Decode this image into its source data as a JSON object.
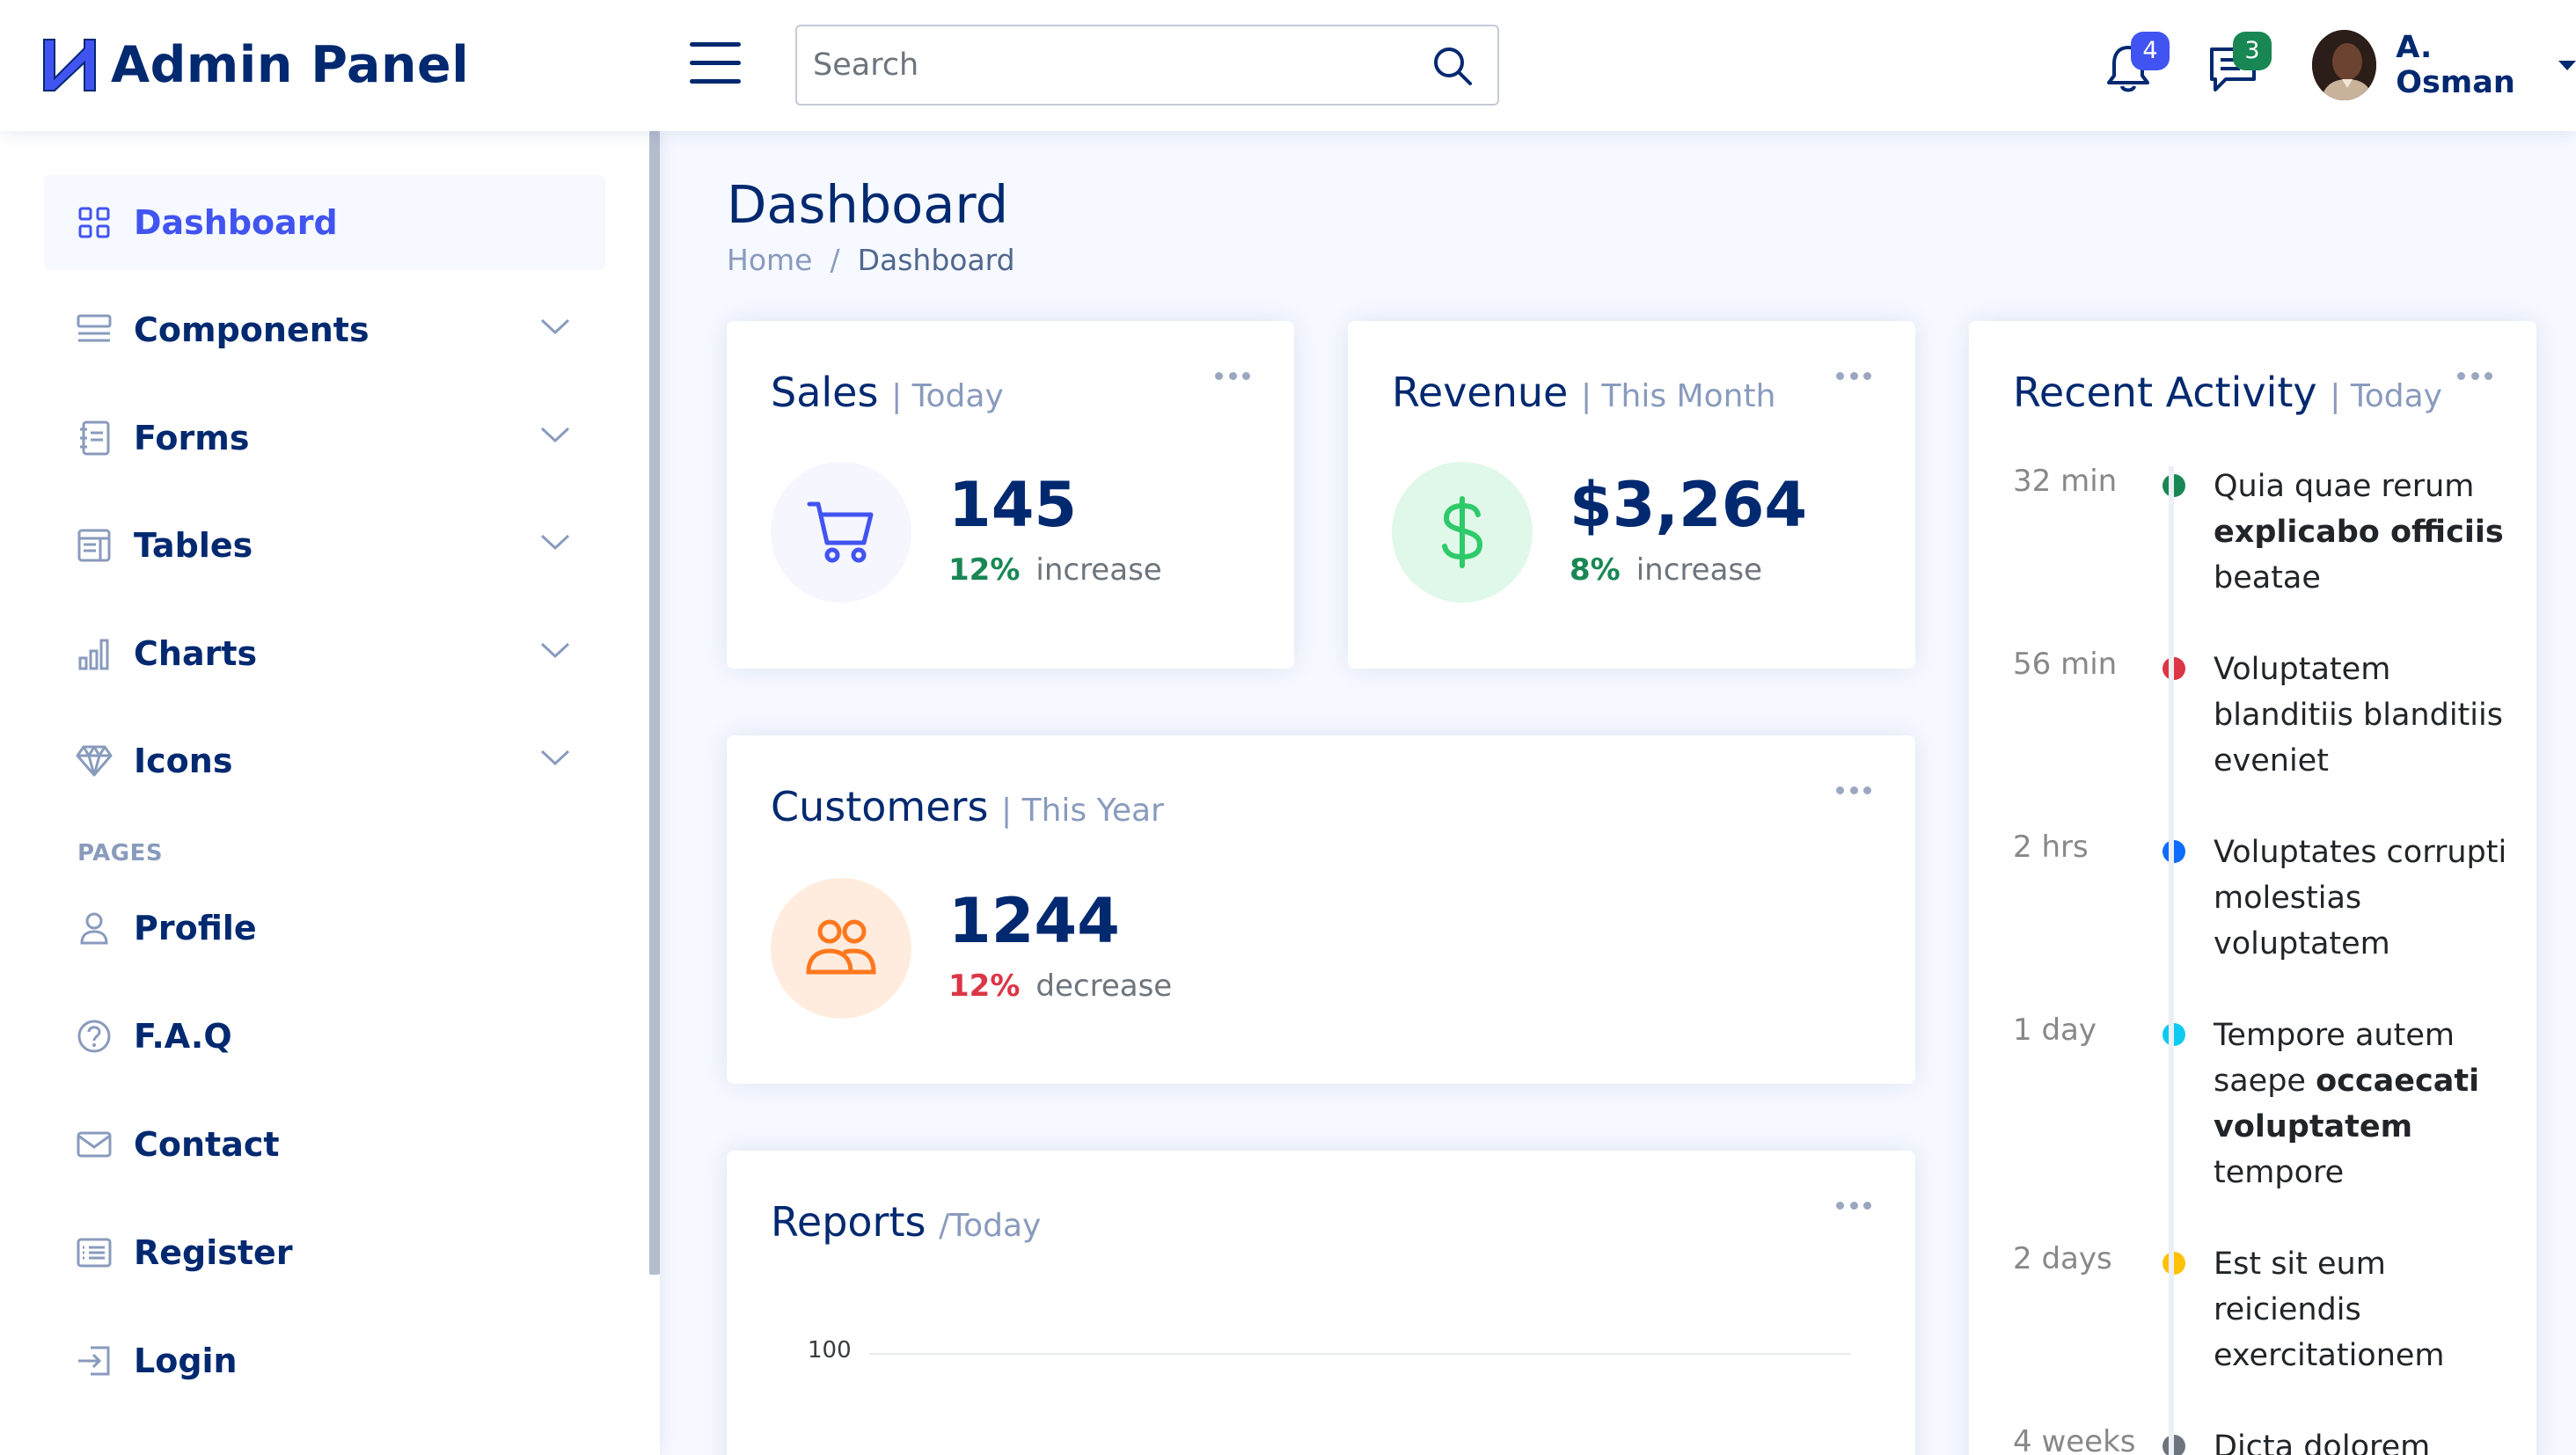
{
  "brand": {
    "name": "Admin Panel",
    "color": "#012970",
    "accent": "#4154f1"
  },
  "search": {
    "placeholder": "Search"
  },
  "header": {
    "notifications_count": "4",
    "messages_count": "3",
    "notifications_badge_color": "#4154f1",
    "messages_badge_color": "#198754",
    "user_name": "A. Osman"
  },
  "sidebar": {
    "items": [
      {
        "label": "Dashboard",
        "icon": "grid-icon",
        "active": true
      },
      {
        "label": "Components",
        "icon": "menu-button-icon",
        "expandable": true
      },
      {
        "label": "Forms",
        "icon": "journal-text-icon",
        "expandable": true
      },
      {
        "label": "Tables",
        "icon": "layout-text-window-icon",
        "expandable": true
      },
      {
        "label": "Charts",
        "icon": "bar-chart-icon",
        "expandable": true
      },
      {
        "label": "Icons",
        "icon": "gem-icon",
        "expandable": true
      }
    ],
    "pages_heading": "PAGES",
    "pages": [
      {
        "label": "Profile",
        "icon": "person-icon"
      },
      {
        "label": "F.A.Q",
        "icon": "question-circle-icon"
      },
      {
        "label": "Contact",
        "icon": "envelope-icon"
      },
      {
        "label": "Register",
        "icon": "card-list-icon"
      },
      {
        "label": "Login",
        "icon": "box-arrow-in-right-icon"
      }
    ]
  },
  "page": {
    "title": "Dashboard",
    "breadcrumb": {
      "home": "Home",
      "separator": "/",
      "current": "Dashboard"
    }
  },
  "cards": {
    "sales": {
      "title": "Sales",
      "filter": "| Today",
      "value": "145",
      "change_pct": "12%",
      "change_word": "increase",
      "change_color": "#198754",
      "icon": "cart-icon"
    },
    "revenue": {
      "title": "Revenue",
      "filter": "| This Month",
      "value": "$3,264",
      "change_pct": "8%",
      "change_word": "increase",
      "change_color": "#198754",
      "icon": "currency-dollar-icon"
    },
    "customers": {
      "title": "Customers",
      "filter": "| This Year",
      "value": "1244",
      "change_pct": "12%",
      "change_word": "decrease",
      "change_color": "#dc3545",
      "icon": "people-icon"
    },
    "reports": {
      "title": "Reports",
      "filter": "/Today"
    }
  },
  "activity": {
    "title": "Recent Activity",
    "filter": "| Today",
    "items": [
      {
        "time": "32 min",
        "color": "#198754",
        "parts": [
          "Quia quae rerum ",
          "explicabo officiis",
          " beatae"
        ]
      },
      {
        "time": "56 min",
        "color": "#dc3545",
        "parts": [
          "Voluptatem blanditiis blanditiis eveniet",
          "",
          ""
        ]
      },
      {
        "time": "2 hrs",
        "color": "#0d6efd",
        "parts": [
          "Voluptates corrupti molestias voluptatem",
          "",
          ""
        ]
      },
      {
        "time": "1 day",
        "color": "#0dcaf0",
        "parts": [
          "Tempore autem saepe ",
          "occaecati voluptatem",
          " tempore"
        ]
      },
      {
        "time": "2 days",
        "color": "#ffc107",
        "parts": [
          "Est sit eum reiciendis exercitationem",
          "",
          ""
        ]
      },
      {
        "time": "4 weeks",
        "color": "#6c757d",
        "parts": [
          "Dicta dolorem",
          "",
          ""
        ]
      }
    ]
  },
  "chart_data": {
    "type": "line",
    "title": "",
    "y_ticks": [
      "100"
    ],
    "series": []
  }
}
